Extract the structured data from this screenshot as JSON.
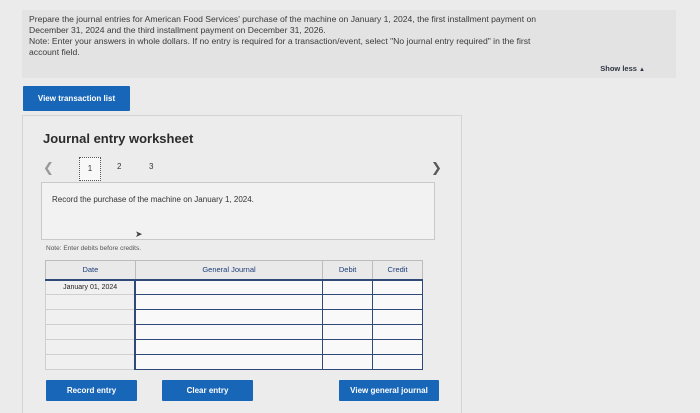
{
  "instructions": {
    "line1": "Prepare the journal entries for American Food Services' purchase of the machine on January 1, 2024, the first installment payment on",
    "line2": "December 31, 2024 and the third installment payment on December 31, 2026.",
    "line3": "Note: Enter your answers in whole dollars. If no entry is required for a transaction/event, select \"No journal entry required\" in the first",
    "line4": "account field.",
    "show_less": "Show less"
  },
  "buttons": {
    "view_transaction": "View transaction list",
    "record_entry": "Record entry",
    "clear_entry": "Clear entry",
    "view_general_journal": "View general journal"
  },
  "worksheet": {
    "title": "Journal entry worksheet",
    "pages": [
      "1",
      "2",
      "3"
    ],
    "current_page": "1",
    "prompt": "Record the purchase of the machine on January 1, 2024.",
    "note": "Note: Enter debits before credits."
  },
  "table": {
    "headers": {
      "date": "Date",
      "account": "General Journal",
      "debit": "Debit",
      "credit": "Credit"
    },
    "rows": [
      {
        "date": "January 01, 2024",
        "account": "",
        "debit": "",
        "credit": ""
      },
      {
        "date": "",
        "account": "",
        "debit": "",
        "credit": ""
      },
      {
        "date": "",
        "account": "",
        "debit": "",
        "credit": ""
      },
      {
        "date": "",
        "account": "",
        "debit": "",
        "credit": ""
      },
      {
        "date": "",
        "account": "",
        "debit": "",
        "credit": ""
      },
      {
        "date": "",
        "account": "",
        "debit": "",
        "credit": ""
      }
    ]
  },
  "colors": {
    "accent": "#1866b8",
    "table_border": "#2f4a78",
    "header_text": "#1d3d7a"
  }
}
